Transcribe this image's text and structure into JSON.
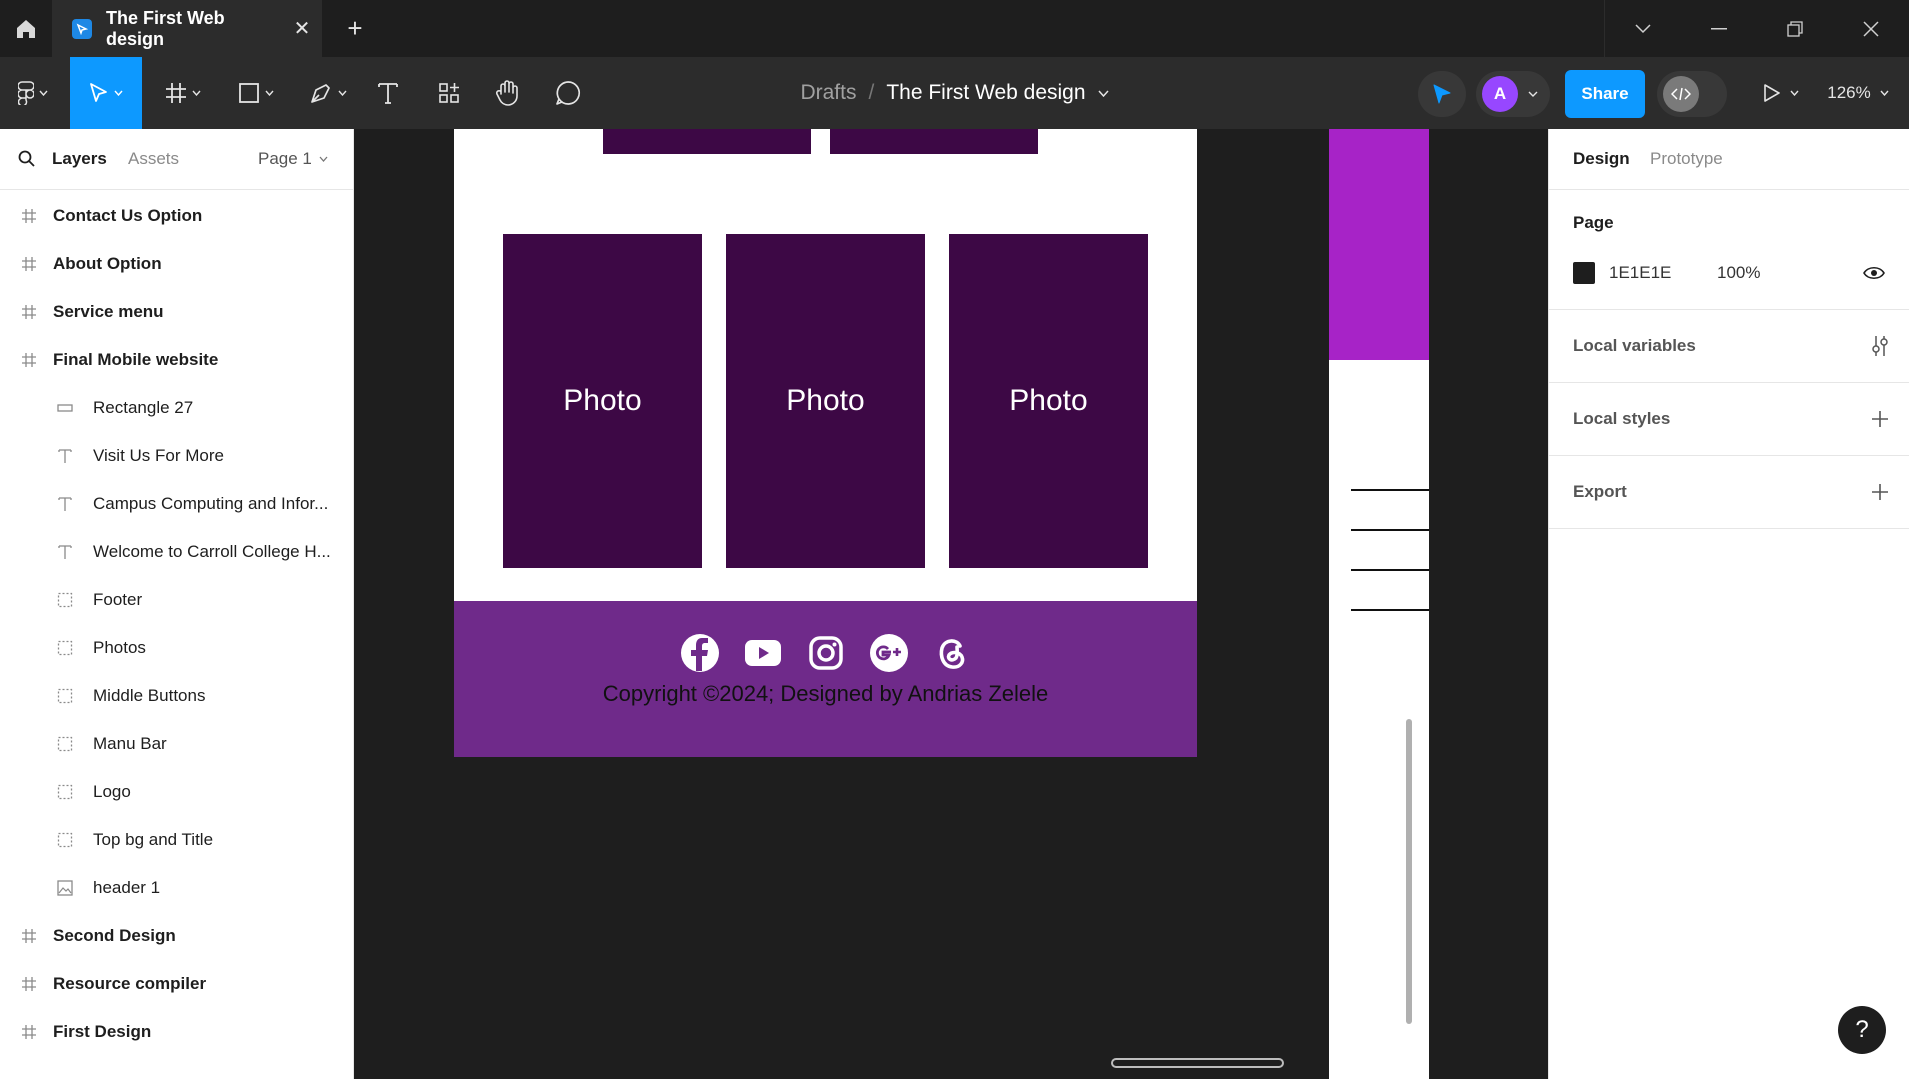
{
  "tabbar": {
    "tab_title": "The First Web design",
    "close_glyph": "✕",
    "new_tab_glyph": "+"
  },
  "toolbar": {
    "breadcrumb_root": "Drafts",
    "breadcrumb_sep": "/",
    "file_name": "The First Web design",
    "avatar_letter": "A",
    "share_label": "Share",
    "zoom_label": "126%"
  },
  "left_panel": {
    "tab_layers": "Layers",
    "tab_assets": "Assets",
    "page_selector": "Page 1",
    "layers": [
      {
        "label": "Contact Us Option",
        "type": "frame",
        "level": 0
      },
      {
        "label": "About Option",
        "type": "frame",
        "level": 0
      },
      {
        "label": "Service menu",
        "type": "frame",
        "level": 0
      },
      {
        "label": "Final Mobile website",
        "type": "frame",
        "level": 0
      },
      {
        "label": "Rectangle 27",
        "type": "rectangle",
        "level": 1
      },
      {
        "label": "Visit Us For More",
        "type": "text",
        "level": 1
      },
      {
        "label": "Campus Computing and Infor...",
        "type": "text",
        "level": 1
      },
      {
        "label": "Welcome to Carroll College H...",
        "type": "text",
        "level": 1
      },
      {
        "label": "Footer",
        "type": "group",
        "level": 1
      },
      {
        "label": "Photos",
        "type": "group",
        "level": 1
      },
      {
        "label": "Middle Buttons",
        "type": "group",
        "level": 1
      },
      {
        "label": "Manu Bar",
        "type": "group",
        "level": 1
      },
      {
        "label": "Logo",
        "type": "group",
        "level": 1
      },
      {
        "label": "Top bg and Title",
        "type": "group",
        "level": 1
      },
      {
        "label": "header 1",
        "type": "image",
        "level": 1
      },
      {
        "label": "Second Design",
        "type": "frame",
        "level": 0
      },
      {
        "label": "Resource compiler",
        "type": "frame",
        "level": 0
      },
      {
        "label": "First Design",
        "type": "frame",
        "level": 0
      }
    ]
  },
  "canvas": {
    "photo_labels": [
      "Photo",
      "Photo",
      "Photo"
    ],
    "copyright": "Copyright ©2024; Designed by Andrias Zelele",
    "social_icons": [
      "facebook-icon",
      "youtube-icon",
      "instagram-icon",
      "google-plus-icon",
      "threads-icon"
    ],
    "colors": {
      "photo_bg": "#3d0845",
      "footer_bg": "#6f2a8a",
      "accent_magenta": "#a723c7"
    }
  },
  "right_panel": {
    "tab_design": "Design",
    "tab_prototype": "Prototype",
    "page_heading": "Page",
    "page_color_hex": "1E1E1E",
    "page_opacity": "100%",
    "sections": [
      "Local variables",
      "Local styles",
      "Export"
    ]
  },
  "help_glyph": "?"
}
